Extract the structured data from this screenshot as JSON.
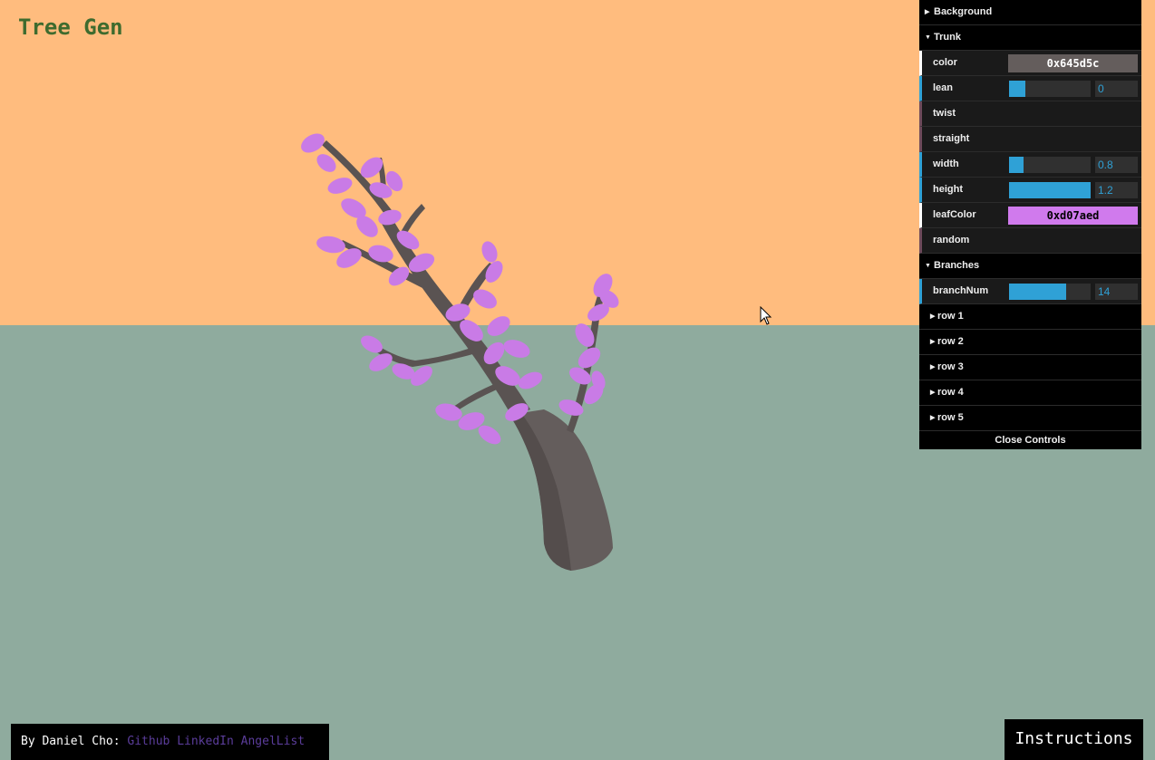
{
  "title": "Tree Gen",
  "colors": {
    "sky": "#ffbc7e",
    "ground": "#8fab9e",
    "trunk": "#645d5c",
    "leaf": "#d07aed",
    "slider_accent": "#2fa1d6"
  },
  "gui": {
    "folders": {
      "background": "Background",
      "trunk": "Trunk",
      "branches": "Branches"
    },
    "trunk": {
      "color_label": "color",
      "color_value": "0x645d5c",
      "lean_label": "lean",
      "lean_value": "0",
      "lean_fraction": 0.2,
      "twist_label": "twist",
      "straight_label": "straight",
      "width_label": "width",
      "width_value": "0.8",
      "width_fraction": 0.18,
      "height_label": "height",
      "height_value": "1.2",
      "height_fraction": 1.0,
      "leafcolor_label": "leafColor",
      "leafcolor_value": "0xd07aed",
      "random_label": "random"
    },
    "branches": {
      "branchnum_label": "branchNum",
      "branchnum_value": "14",
      "branchnum_fraction": 0.7,
      "rows": [
        "row 1",
        "row 2",
        "row 3",
        "row 4",
        "row 5"
      ]
    },
    "close_label": "Close Controls"
  },
  "footer": {
    "author": "By Daniel Cho:",
    "links": [
      "Github",
      "LinkedIn",
      "AngelList"
    ],
    "instructions": "Instructions"
  }
}
